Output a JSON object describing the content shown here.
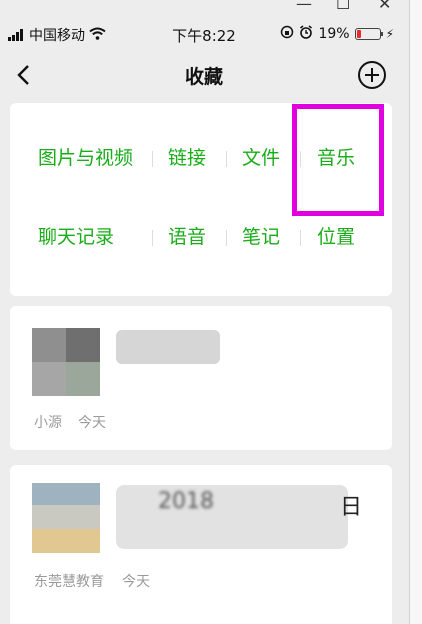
{
  "window": {
    "minimize": "—",
    "maximize": "☐",
    "close": "✕"
  },
  "status_bar": {
    "carrier": "中国移动",
    "time": "下午8:22",
    "battery_percent": "19%",
    "battery_level": 0.19
  },
  "nav": {
    "title": "收藏"
  },
  "categories": {
    "row1": [
      "图片与视频",
      "链接",
      "文件",
      "音乐"
    ],
    "row2": [
      "聊天记录",
      "语音",
      "笔记",
      "位置"
    ]
  },
  "items": [
    {
      "source": "小源",
      "date": "今天"
    },
    {
      "source": "东莞慧教育",
      "date": "今天",
      "title_fragment": "2018",
      "title_tail": "日"
    }
  ],
  "colors": {
    "accent": "#1aad19",
    "highlight": "#e000e0"
  }
}
